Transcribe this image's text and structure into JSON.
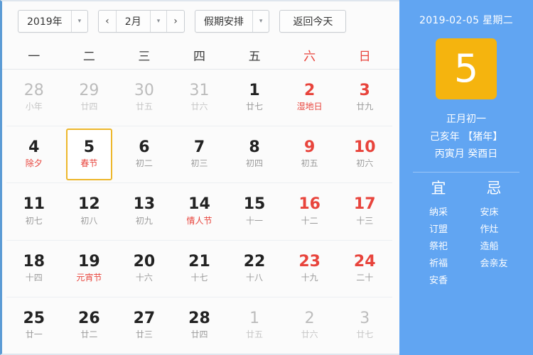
{
  "toolbar": {
    "year_value": "2019年",
    "year_caret": "▾",
    "prev_arrow": "‹",
    "month_value": "2月",
    "month_caret": "▾",
    "next_arrow": "›",
    "holiday_label": "假期安排",
    "holiday_caret": "▾",
    "today_button": "返回今天"
  },
  "weekdays": [
    {
      "label": "一",
      "weekend": false
    },
    {
      "label": "二",
      "weekend": false
    },
    {
      "label": "三",
      "weekend": false
    },
    {
      "label": "四",
      "weekend": false
    },
    {
      "label": "五",
      "weekend": false
    },
    {
      "label": "六",
      "weekend": true
    },
    {
      "label": "日",
      "weekend": true
    }
  ],
  "weeks": [
    [
      {
        "num": "28",
        "sub": "小年",
        "muted": true,
        "red": false,
        "sub_red": false,
        "selected": false
      },
      {
        "num": "29",
        "sub": "廿四",
        "muted": true,
        "red": false,
        "sub_red": false,
        "selected": false
      },
      {
        "num": "30",
        "sub": "廿五",
        "muted": true,
        "red": false,
        "sub_red": false,
        "selected": false
      },
      {
        "num": "31",
        "sub": "廿六",
        "muted": true,
        "red": false,
        "sub_red": false,
        "selected": false
      },
      {
        "num": "1",
        "sub": "廿七",
        "muted": false,
        "red": false,
        "sub_red": false,
        "selected": false
      },
      {
        "num": "2",
        "sub": "湿地日",
        "muted": false,
        "red": true,
        "sub_red": true,
        "selected": false
      },
      {
        "num": "3",
        "sub": "廿九",
        "muted": false,
        "red": true,
        "sub_red": false,
        "selected": false
      }
    ],
    [
      {
        "num": "4",
        "sub": "除夕",
        "muted": false,
        "red": false,
        "sub_red": true,
        "selected": false
      },
      {
        "num": "5",
        "sub": "春节",
        "muted": false,
        "red": false,
        "sub_red": true,
        "selected": true
      },
      {
        "num": "6",
        "sub": "初二",
        "muted": false,
        "red": false,
        "sub_red": false,
        "selected": false
      },
      {
        "num": "7",
        "sub": "初三",
        "muted": false,
        "red": false,
        "sub_red": false,
        "selected": false
      },
      {
        "num": "8",
        "sub": "初四",
        "muted": false,
        "red": false,
        "sub_red": false,
        "selected": false
      },
      {
        "num": "9",
        "sub": "初五",
        "muted": false,
        "red": true,
        "sub_red": false,
        "selected": false
      },
      {
        "num": "10",
        "sub": "初六",
        "muted": false,
        "red": true,
        "sub_red": false,
        "selected": false
      }
    ],
    [
      {
        "num": "11",
        "sub": "初七",
        "muted": false,
        "red": false,
        "sub_red": false,
        "selected": false
      },
      {
        "num": "12",
        "sub": "初八",
        "muted": false,
        "red": false,
        "sub_red": false,
        "selected": false
      },
      {
        "num": "13",
        "sub": "初九",
        "muted": false,
        "red": false,
        "sub_red": false,
        "selected": false
      },
      {
        "num": "14",
        "sub": "情人节",
        "muted": false,
        "red": false,
        "sub_red": true,
        "selected": false
      },
      {
        "num": "15",
        "sub": "十一",
        "muted": false,
        "red": false,
        "sub_red": false,
        "selected": false
      },
      {
        "num": "16",
        "sub": "十二",
        "muted": false,
        "red": true,
        "sub_red": false,
        "selected": false
      },
      {
        "num": "17",
        "sub": "十三",
        "muted": false,
        "red": true,
        "sub_red": false,
        "selected": false
      }
    ],
    [
      {
        "num": "18",
        "sub": "十四",
        "muted": false,
        "red": false,
        "sub_red": false,
        "selected": false
      },
      {
        "num": "19",
        "sub": "元宵节",
        "muted": false,
        "red": false,
        "sub_red": true,
        "selected": false
      },
      {
        "num": "20",
        "sub": "十六",
        "muted": false,
        "red": false,
        "sub_red": false,
        "selected": false
      },
      {
        "num": "21",
        "sub": "十七",
        "muted": false,
        "red": false,
        "sub_red": false,
        "selected": false
      },
      {
        "num": "22",
        "sub": "十八",
        "muted": false,
        "red": false,
        "sub_red": false,
        "selected": false
      },
      {
        "num": "23",
        "sub": "十九",
        "muted": false,
        "red": true,
        "sub_red": false,
        "selected": false
      },
      {
        "num": "24",
        "sub": "二十",
        "muted": false,
        "red": true,
        "sub_red": false,
        "selected": false
      }
    ],
    [
      {
        "num": "25",
        "sub": "廿一",
        "muted": false,
        "red": false,
        "sub_red": false,
        "selected": false
      },
      {
        "num": "26",
        "sub": "廿二",
        "muted": false,
        "red": false,
        "sub_red": false,
        "selected": false
      },
      {
        "num": "27",
        "sub": "廿三",
        "muted": false,
        "red": false,
        "sub_red": false,
        "selected": false
      },
      {
        "num": "28",
        "sub": "廿四",
        "muted": false,
        "red": false,
        "sub_red": false,
        "selected": false
      },
      {
        "num": "1",
        "sub": "廿五",
        "muted": true,
        "red": false,
        "sub_red": false,
        "selected": false
      },
      {
        "num": "2",
        "sub": "廿六",
        "muted": true,
        "red": false,
        "sub_red": false,
        "selected": false
      },
      {
        "num": "3",
        "sub": "廿七",
        "muted": true,
        "red": false,
        "sub_red": false,
        "selected": false
      }
    ]
  ],
  "sidebar": {
    "date_line": "2019-02-05 星期二",
    "big_day": "5",
    "lunar_lines": [
      "正月初一",
      "己亥年 【猪年】",
      "丙寅月 癸酉日"
    ],
    "yi_head": "宜",
    "ji_head": "忌",
    "yi_items": [
      "纳采",
      "订盟",
      "祭祀",
      "祈福",
      "安香"
    ],
    "ji_items": [
      "安床",
      "作灶",
      "造船",
      "会亲友"
    ]
  },
  "colors": {
    "sidebar_blue": "#61a5f2",
    "accent_orange": "#f5b40e",
    "selected_border": "#edb72b",
    "weekend_red": "#e8443c",
    "left_edge_blue": "#5b9bd5"
  }
}
